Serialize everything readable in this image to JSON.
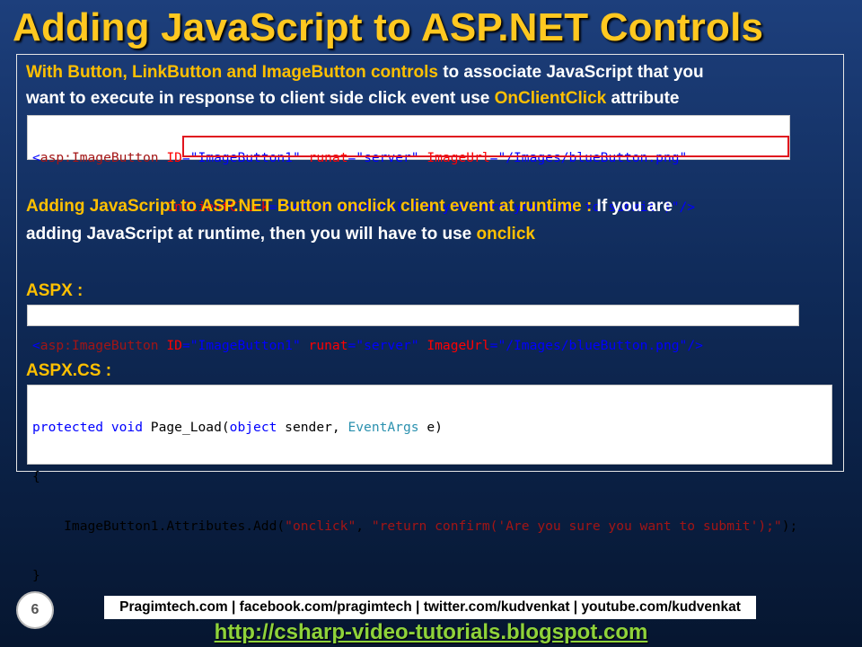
{
  "slide": {
    "title": "Adding JavaScript to ASP.NET Controls",
    "page_number": "6"
  },
  "section1": {
    "line1_hl": "With Button, LinkButton and ImageButton controls",
    "line1_rest": " to associate JavaScript that you",
    "line2_pre": "want to execute in response to client side click event use ",
    "line2_hl": "OnClientClick",
    "line2_post": " attribute"
  },
  "code1": {
    "l1_open": "<",
    "l1_tag": "asp:ImageButton",
    "l1_a1": " ID",
    "l1_eq1": "=",
    "l1_v1": "\"ImageButton1\"",
    "l1_a2": " runat",
    "l1_eq2": "=",
    "l1_v2": "\"server\"",
    "l1_a3": " ImageUrl",
    "l1_eq3": "=",
    "l1_v3": "\"/Images/blueButton.png\"",
    "l2_indent": "                 ",
    "l2_a": "OnClientClick",
    "l2_eq": "=",
    "l2_v": "\"return confirm('Are you sure you want to submit')\"",
    "l2_close": "/>"
  },
  "section2": {
    "line1_hl": "Adding JavaScript to ASP.NET Button onclick client event at runtime :",
    "line1_rest": " If you are",
    "line2_pre": "adding JavaScript at runtime, then you will have to use ",
    "line2_hl": "onclick"
  },
  "aspx": {
    "label": "ASPX :"
  },
  "code2": {
    "open": "<",
    "tag": "asp:ImageButton",
    "a1": " ID",
    "eq1": "=",
    "v1": "\"ImageButton1\"",
    "a2": " runat",
    "eq2": "=",
    "v2": "\"server\"",
    "a3": " ImageUrl",
    "eq3": "=",
    "v3": "\"/Images/blueButton.png\"",
    "close": "/>"
  },
  "aspxcs": {
    "label": "ASPX.CS :"
  },
  "code3": {
    "kw1": "protected",
    "kw2": " void",
    "method": " Page_Load(",
    "kw3": "object",
    "p1": " sender, ",
    "type": "EventArgs",
    "p2": " e)",
    "brace_open": "{",
    "stmt_pre": "    ImageButton1.Attributes.Add(",
    "str1": "\"onclick\"",
    "comma": ", ",
    "str2": "\"return confirm('Are you sure you want to submit');\"",
    "stmt_end": ");",
    "brace_close": "}"
  },
  "footer": {
    "links": "Pragimtech.com | facebook.com/pragimtech | twitter.com/kudvenkat | youtube.com/kudvenkat",
    "url": "http://csharp-video-tutorials.blogspot.com"
  }
}
